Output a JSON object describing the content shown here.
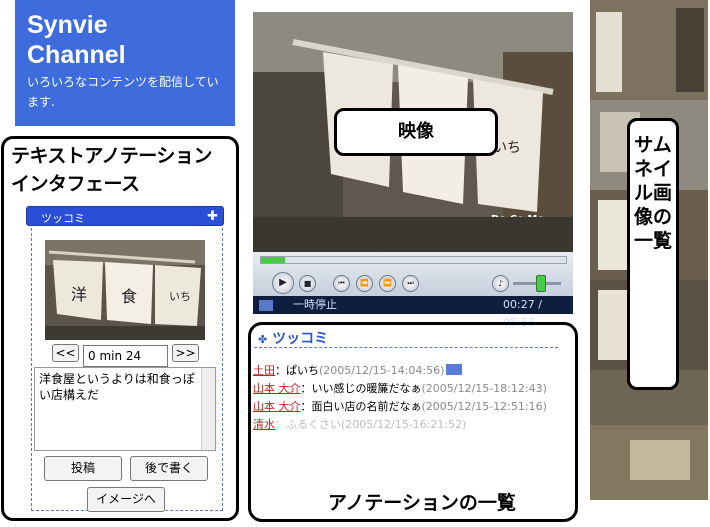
{
  "header": {
    "title_line1": "Synvie",
    "title_line2": "Channel",
    "subtitle": "いろいろなコンテンツを配信しています."
  },
  "left_panel": {
    "title_line1": "テキストアノテーション",
    "title_line2": "インタフェース",
    "section_label": "ツッコミ",
    "prev_button": "<<",
    "time_value": "0 min 24 sec.",
    "next_button": ">>",
    "comment_text": "洋食屋というよりは和食っぽい店構えだ",
    "post_button": "投稿",
    "later_button": "後で書く",
    "image_button": "イメージへ"
  },
  "video": {
    "label": "映像",
    "status": "一時停止",
    "time": "00:27 / 05:33",
    "progress": 0.08,
    "volume": 0.55
  },
  "annotations": {
    "header": "ツッコミ",
    "items": [
      {
        "user": "土田",
        "text": "：ぱいち",
        "time": "(2005/12/15-14:04:56)"
      },
      {
        "user": "山本 大介",
        "text": "：いい感じの暖簾だなぁ",
        "time": "(2005/12/15-18:12:43)"
      },
      {
        "user": "山本 大介",
        "text": "：面白い店の名前だなぁ",
        "time": "(2005/12/15-12:51:16)"
      },
      {
        "user": "清水",
        "text": "：ふるくさい",
        "time": "(2005/12/15-16:21:52)"
      }
    ],
    "label": "アノテーションの一覧"
  },
  "thumbnails": {
    "label": "サムネイル画像の一覧"
  },
  "colors": {
    "header_bg": "#3f6cdc",
    "accent_blue": "#2e55c8",
    "user_red": "#c81e1e"
  }
}
